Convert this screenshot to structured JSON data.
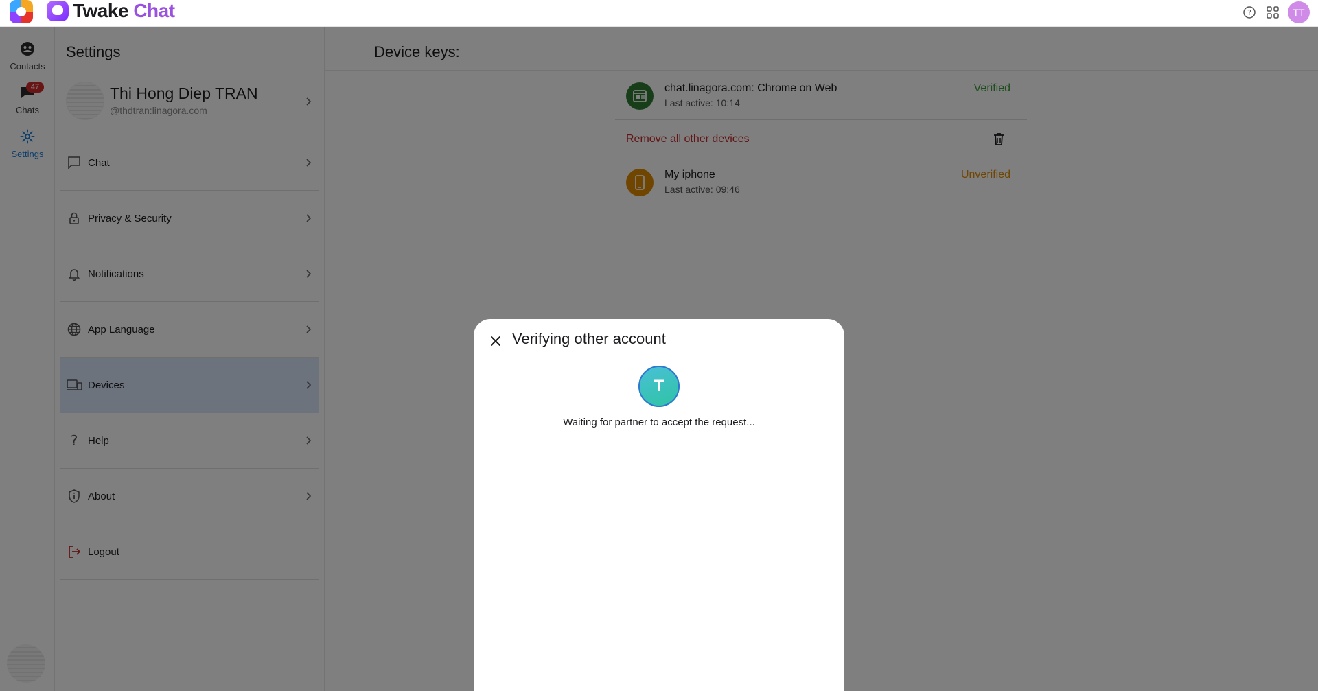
{
  "topbar": {
    "brand_primary": "Twake",
    "brand_accent": "Chat",
    "avatar_initials": "TT"
  },
  "rail": {
    "items": [
      {
        "label": "Contacts",
        "icon": "contacts-icon"
      },
      {
        "label": "Chats",
        "icon": "chat-bubble-icon",
        "badge": "47"
      },
      {
        "label": "Settings",
        "icon": "gear-icon",
        "active": true
      }
    ]
  },
  "settings": {
    "title": "Settings",
    "profile": {
      "name": "Thi Hong Diep TRAN",
      "handle": "@thdtran:linagora.com"
    },
    "menu": [
      {
        "label": "Chat",
        "icon": "chat-outline-icon"
      },
      {
        "label": "Privacy & Security",
        "icon": "lock-icon"
      },
      {
        "label": "Notifications",
        "icon": "bell-icon"
      },
      {
        "label": "App Language",
        "icon": "globe-icon"
      },
      {
        "label": "Devices",
        "icon": "devices-icon",
        "active": true
      },
      {
        "label": "Help",
        "icon": "question-icon"
      },
      {
        "label": "About",
        "icon": "shield-info-icon"
      },
      {
        "label": "Logout",
        "icon": "logout-icon"
      }
    ]
  },
  "main": {
    "title": "Device keys:",
    "devices": [
      {
        "name": "chat.linagora.com: Chrome on Web",
        "last_active": "Last active: 10:14",
        "status": "Verified",
        "status_color": "#3a9b3a",
        "icon_color": "#2e7d32"
      },
      {
        "name": "My iphone",
        "last_active": "Last active: 09:46",
        "status": "Unverified",
        "status_color": "#e08a00",
        "icon_color": "#e08a00"
      }
    ],
    "remove_all_label": "Remove all other devices"
  },
  "dialog": {
    "title": "Verifying other account",
    "avatar_letter": "T",
    "message": "Waiting for partner to accept the request..."
  }
}
